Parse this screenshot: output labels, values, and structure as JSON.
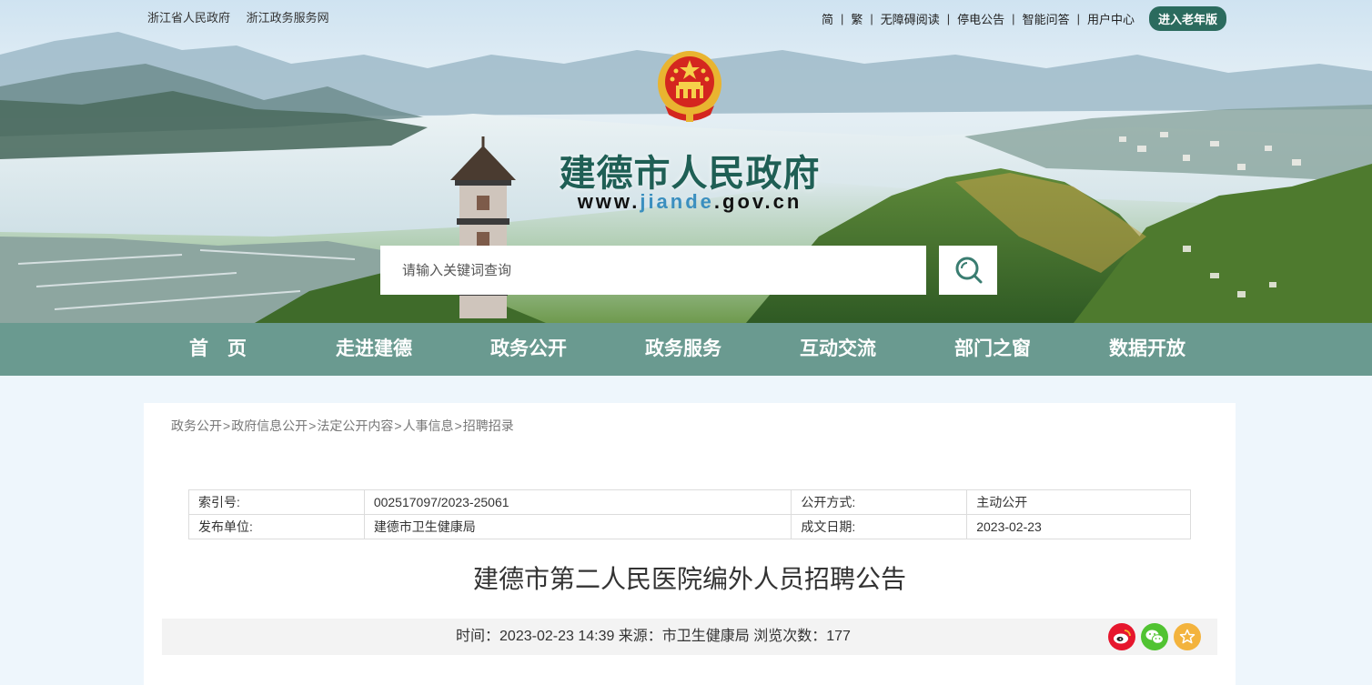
{
  "topbar": {
    "left_links": [
      "浙江省人民政府",
      "浙江政务服务网"
    ],
    "right_links": [
      "简",
      "繁",
      "无障碍阅读",
      "停电公告",
      "智能问答",
      "用户中心"
    ],
    "elder_button": "进入老年版"
  },
  "site": {
    "title": "建德市人民政府",
    "url_prefix": "www.",
    "url_highlight": "jiande",
    "url_suffix": ".gov.cn"
  },
  "search": {
    "placeholder": "请输入关键词查询"
  },
  "nav": [
    "首　页",
    "走进建德",
    "政务公开",
    "政务服务",
    "互动交流",
    "部门之窗",
    "数据开放"
  ],
  "breadcrumb": [
    "政务公开",
    "政府信息公开",
    "法定公开内容",
    "人事信息",
    "招聘招录"
  ],
  "breadcrumb_separator": ">",
  "meta": {
    "index_label": "索引号:",
    "index_value": "002517097/2023-25061",
    "disclosure_label": "公开方式:",
    "disclosure_value": "主动公开",
    "publisher_label": "发布单位:",
    "publisher_value": "建德市卫生健康局",
    "date_label": "成文日期:",
    "date_value": "2023-02-23"
  },
  "article": {
    "title": "建德市第二人民医院编外人员招聘公告",
    "info": "时间：2023-02-23 14:39 来源：市卫生健康局 浏览次数：177"
  },
  "share_icons": [
    "weibo-icon",
    "wechat-icon",
    "favorite-icon"
  ],
  "colors": {
    "nav_bg": "#6a9a90",
    "title_green": "#1f5f55",
    "elder_button_bg": "#2b6b5e",
    "weibo": "#e6162d",
    "wechat": "#51c332",
    "favorite": "#f3b33d"
  }
}
